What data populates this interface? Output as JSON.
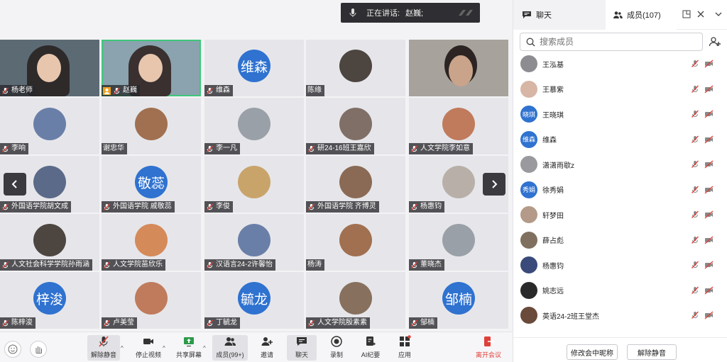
{
  "speaking": {
    "label": "正在讲话:",
    "name": "赵巍;"
  },
  "grid": {
    "tiles": [
      {
        "name": "杨老师",
        "kind": "video"
      },
      {
        "name": "赵巍",
        "kind": "video-active"
      },
      {
        "name": "维森",
        "avatar_text": "维森"
      },
      {
        "name": "陈缘"
      },
      {
        "name": ""
      },
      {
        "name": "李响"
      },
      {
        "name": "谢忠华"
      },
      {
        "name": "李一凡"
      },
      {
        "name": "研24-16班王嘉欣"
      },
      {
        "name": "人文学院李如意"
      },
      {
        "name": "外国语学院胡文成"
      },
      {
        "name": "外国语学院 戚敬蕊",
        "avatar_text": "敬蕊"
      },
      {
        "name": "李俊"
      },
      {
        "name": "外国语学院 齐博灵"
      },
      {
        "name": "杨惠钧"
      },
      {
        "name": "人文社会科学学院孙雨涵"
      },
      {
        "name": "人文学院苗欣乐"
      },
      {
        "name": "汉语言24-2许馨怡"
      },
      {
        "name": "杨涛"
      },
      {
        "name": "董晓杰"
      },
      {
        "name": "陈梓浚",
        "avatar_text": "梓浚"
      },
      {
        "name": "卢美莹"
      },
      {
        "name": "丁毓龙",
        "avatar_text": "毓龙"
      },
      {
        "name": "人文学院殷素素"
      },
      {
        "name": "邹楠",
        "avatar_text": "邹楠"
      }
    ]
  },
  "toolbar": {
    "unmute": "解除静音",
    "stop_video": "停止视频",
    "share": "共享屏幕",
    "members": "成员(99+)",
    "invite": "邀请",
    "chat": "聊天",
    "record": "录制",
    "ai": "AI纪要",
    "apps": "应用",
    "leave": "离开会议"
  },
  "panel": {
    "tab_chat": "聊天",
    "tab_members": "成员(107)",
    "search_placeholder": "搜索成员",
    "members": [
      {
        "name": "王泓基"
      },
      {
        "name": "王慕紫"
      },
      {
        "name": "王晓琪",
        "avatar_text": "晓琪"
      },
      {
        "name": "维森",
        "avatar_text": "维森"
      },
      {
        "name": "潇潇雨歇z"
      },
      {
        "name": "徐秀娟",
        "avatar_text": "秀娟"
      },
      {
        "name": "轩梦田"
      },
      {
        "name": "薛占彪"
      },
      {
        "name": "杨惠钧"
      },
      {
        "name": "姚志远"
      },
      {
        "name": "英语24-2班王堂杰"
      }
    ],
    "rename_button": "修改会中昵称",
    "unmute_button": "解除静音"
  },
  "colors": {
    "accent": "#2f72d0",
    "active_border": "#3ec77a",
    "leave": "#e0403a"
  }
}
